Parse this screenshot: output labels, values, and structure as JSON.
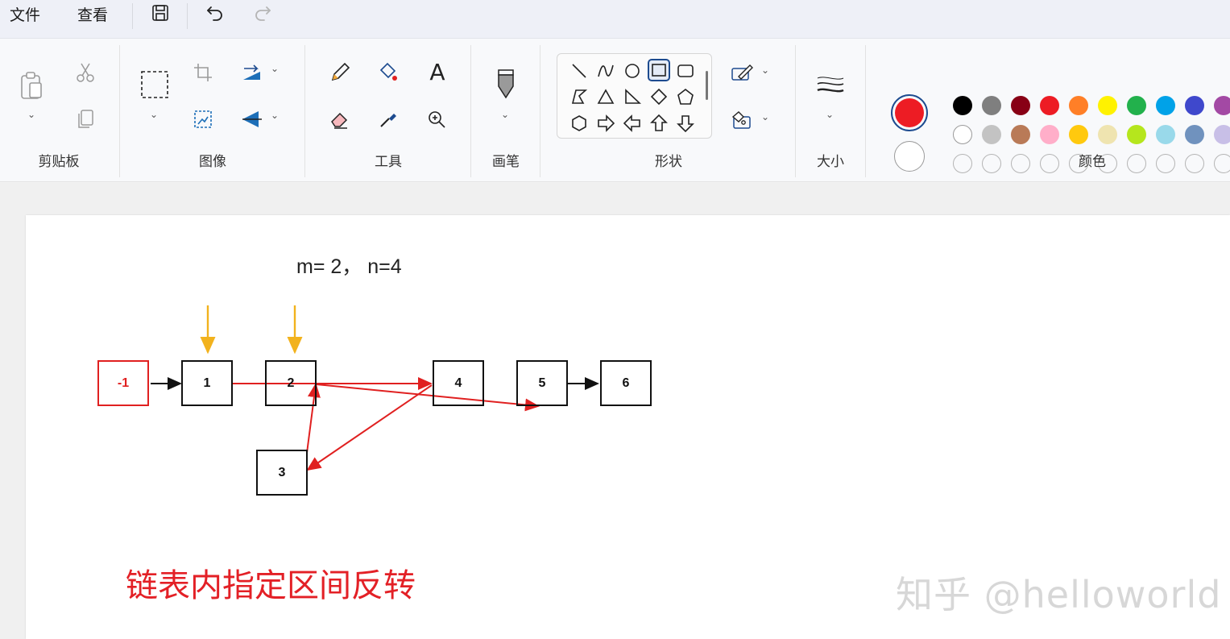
{
  "menu": {
    "file": "文件",
    "view": "查看"
  },
  "toolbar": {
    "save_icon": "save-icon",
    "undo_icon": "undo-icon",
    "redo_icon": "redo-icon"
  },
  "ribbon": {
    "groups": {
      "clipboard": "剪贴板",
      "image": "图像",
      "tools": "工具",
      "brushes": "画笔",
      "shapes": "形状",
      "size": "大小",
      "colors": "颜色"
    },
    "text_tool": "A"
  },
  "colors": {
    "primary": "#ed1c24",
    "secondary": "#ffffff",
    "row1": [
      "#000000",
      "#7f7f7f",
      "#880015",
      "#ed1c24",
      "#ff7f27",
      "#fff200",
      "#22b14c",
      "#00a2e8",
      "#3f48cc",
      "#a349a4"
    ],
    "row2": [
      "#ffffff",
      "#c3c3c3",
      "#b97a57",
      "#ffaec9",
      "#ffc90e",
      "#efe4b0",
      "#b5e61d",
      "#99d9ea",
      "#7092be",
      "#c8bfe7"
    ],
    "accent": "#1d4b8f"
  },
  "canvas": {
    "params": "m= 2，  n=4",
    "nodes": [
      "-1",
      "1",
      "2",
      "4",
      "5",
      "6",
      "3"
    ],
    "caption": "链表内指定区间反转",
    "watermark": "知乎 @helloworld"
  }
}
